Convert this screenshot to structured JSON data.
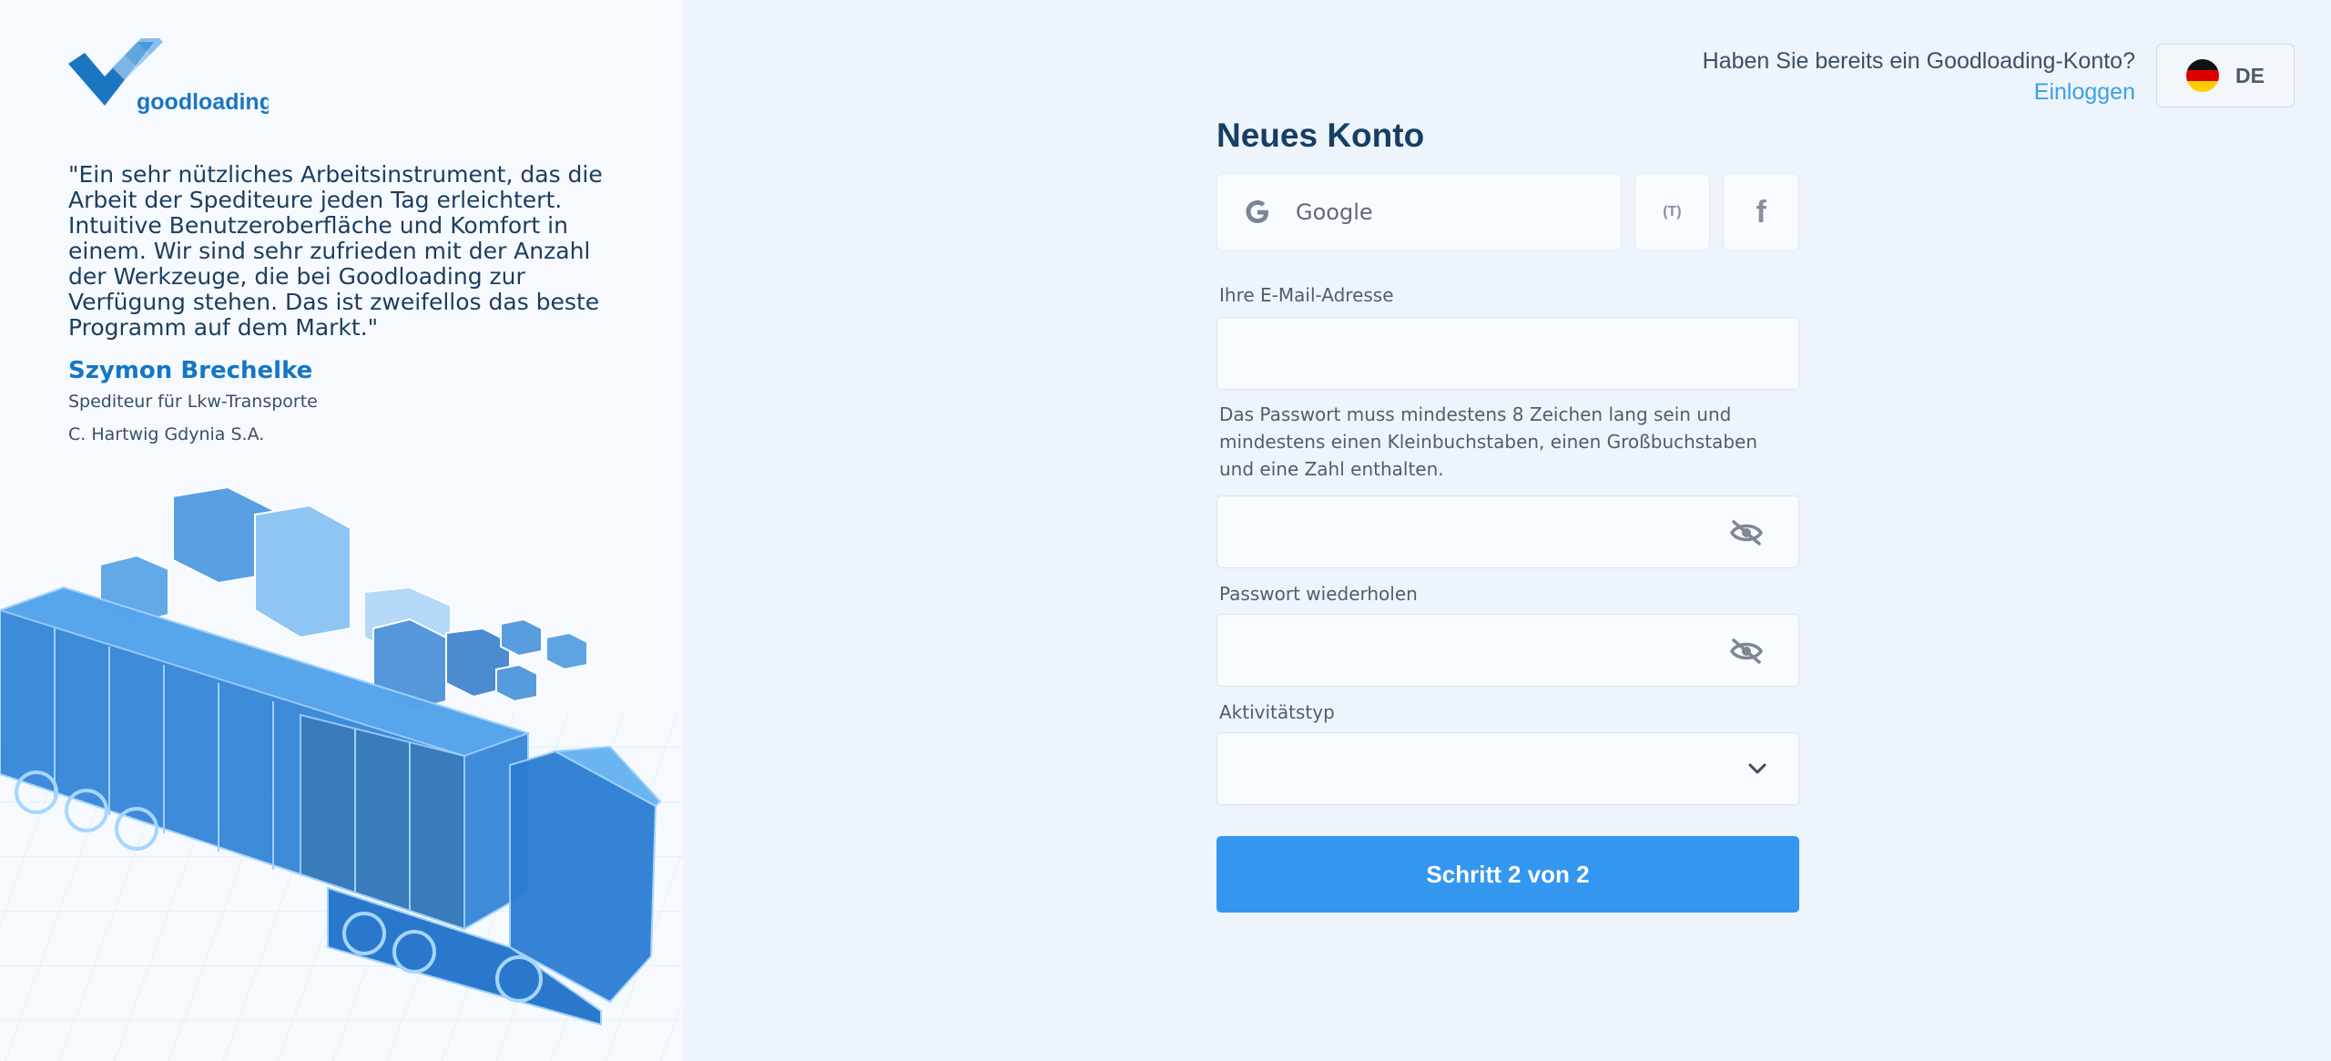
{
  "brand": {
    "name": "goodloading"
  },
  "testimonial": {
    "quote": "\"Ein sehr nützliches Arbeitsinstrument, das die Arbeit der Spediteure jeden Tag erleichtert. Intuitive Benutzeroberfläche und Komfort in einem. Wir sind sehr zufrieden mit der Anzahl der Werkzeuge, die bei Goodloading zur Verfügung stehen. Das ist zweifellos das beste Programm auf dem Markt.\"",
    "author": "Szymon Brechelke",
    "role": "Spediteur für Lkw-Transporte",
    "company": "C. Hartwig Gdynia S.A."
  },
  "header": {
    "have_account": "Haben Sie bereits ein Goodloading-Konto?",
    "login_label": "Einloggen",
    "language": "DE"
  },
  "form": {
    "title": "Neues Konto",
    "social": {
      "google_label": "Google",
      "trans_label": "(T)",
      "facebook_label": "f"
    },
    "email_label": "Ihre E-Mail-Adresse",
    "email_value": "",
    "password_hint": "Das Passwort muss mindestens 8 Zeichen lang sein und mindestens einen Kleinbuchstaben, einen Großbuchstaben und eine Zahl enthalten.",
    "password_value": "",
    "repeat_label": "Passwort wiederholen",
    "repeat_value": "",
    "activity_label": "Aktivitätstyp",
    "activity_value": "",
    "submit_label": "Schritt 2 von 2"
  },
  "colors": {
    "accent": "#3497ef",
    "brand": "#1576c4",
    "link": "#3aa0e6"
  },
  "icons": [
    "goodloading-logo",
    "google-icon",
    "trans-icon",
    "facebook-icon",
    "eye-off-icon",
    "chevron-down-icon",
    "germany-flag-icon"
  ]
}
